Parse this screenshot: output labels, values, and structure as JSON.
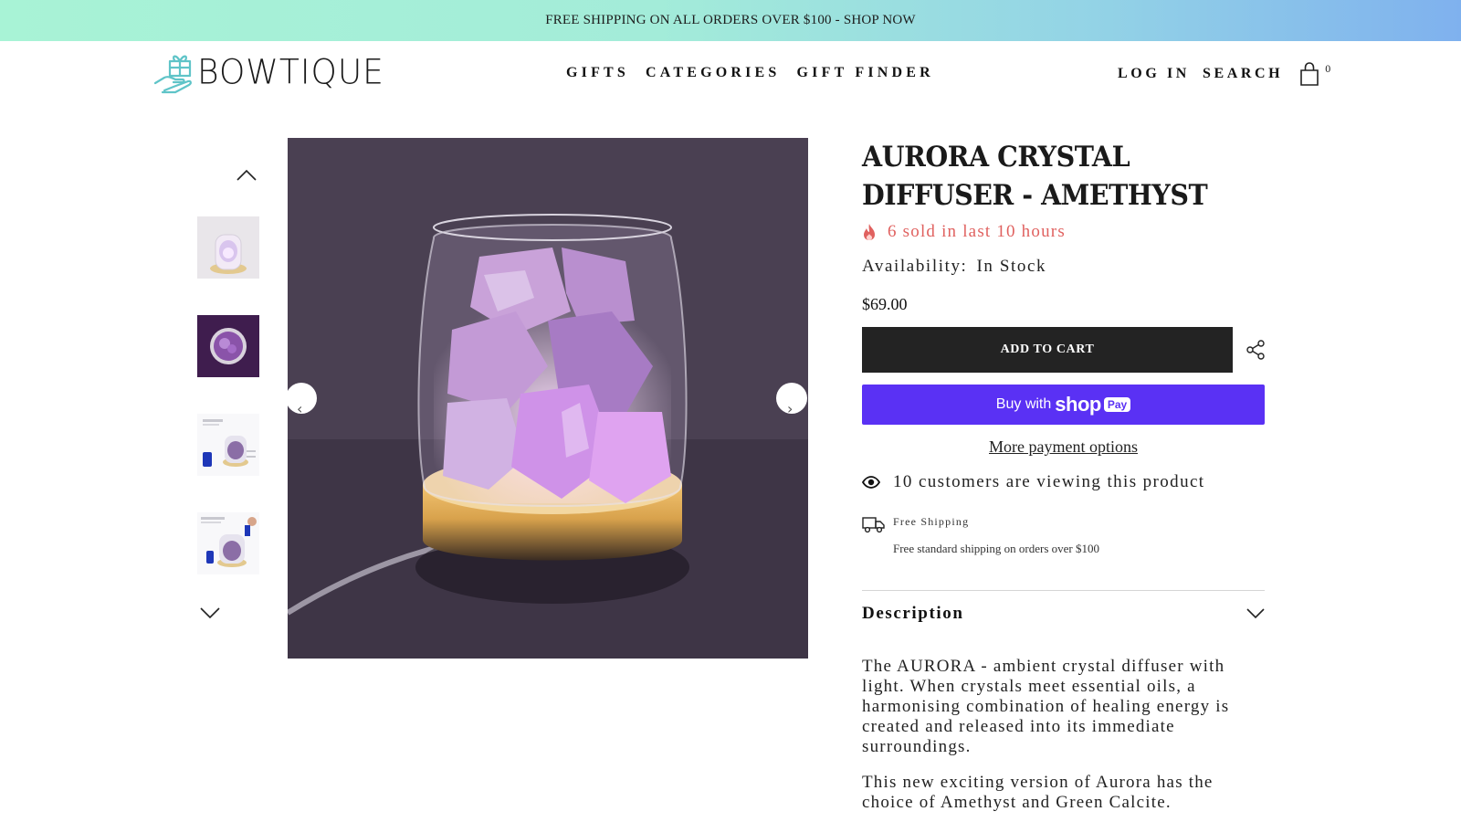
{
  "announcement": {
    "text": "FREE SHIPPING ON ALL ORDERS OVER $100 - SHOP NOW"
  },
  "header": {
    "logo_text": "BOWTIQUE",
    "nav": [
      {
        "label": "GIFTS"
      },
      {
        "label": "CATEGORIES"
      },
      {
        "label": "GIFT FINDER"
      }
    ],
    "login_label": "LOG IN",
    "search_label": "SEARCH",
    "cart_count": "0"
  },
  "gallery": {
    "thumbnail_icons": [
      "chevron-up-icon",
      "chevron-down-icon"
    ],
    "prev_icon": "‹",
    "next_icon": "›"
  },
  "product": {
    "title": "AURORA CRYSTAL DIFFUSER - AMETHYST",
    "sold_text": "6 sold in last 10 hours",
    "availability_label": "Availability:",
    "availability_value": "In Stock",
    "price": "$69.00",
    "add_to_cart_label": "ADD TO CART",
    "shop_pay": {
      "prefix": "Buy with",
      "brand": "shop",
      "badge": "Pay"
    },
    "more_payment_label": "More payment options",
    "viewing_text": "10 customers are viewing this product",
    "shipping_title": "Free Shipping",
    "shipping_sub": "Free standard shipping on orders over $100",
    "description_heading": "Description",
    "description_p1": "The AURORA - ambient crystal diffuser with light. When crystals meet essential oils, a harmonising combination of healing energy is created and released into its immediate surroundings.",
    "description_p2": "This new exciting version of Aurora has the choice of Amethyst and Green Calcite."
  },
  "colors": {
    "sold_accent": "#e0615f",
    "add_to_cart_bg": "#232323",
    "shop_pay_bg": "#5a31f4",
    "announcement_gradient": [
      "#a8f3d6",
      "#7fb1ee"
    ]
  }
}
